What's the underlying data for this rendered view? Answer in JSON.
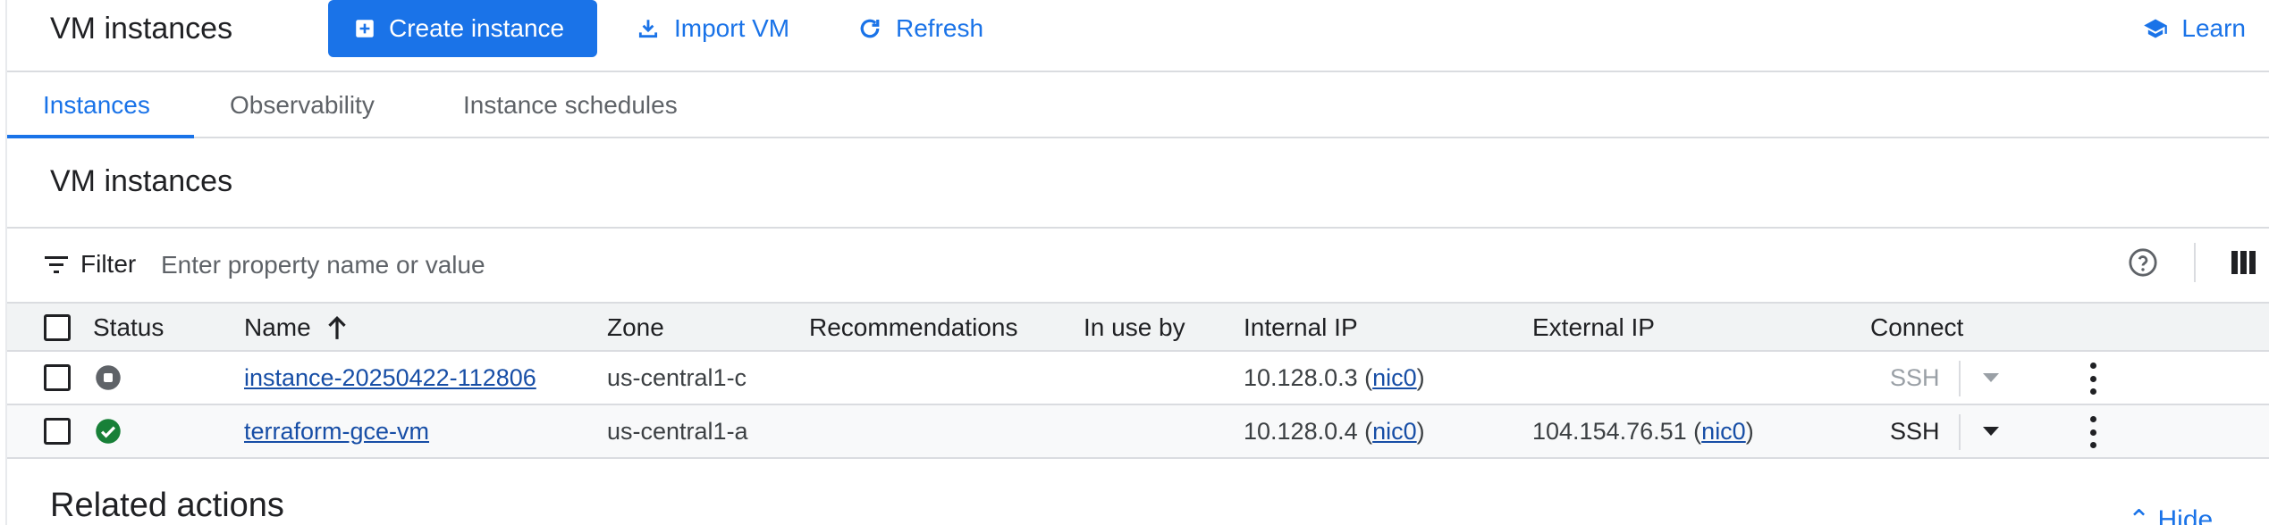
{
  "header": {
    "title": "VM instances",
    "create_label": "Create instance",
    "import_label": "Import VM",
    "refresh_label": "Refresh",
    "learn_label": "Learn"
  },
  "tabs": [
    {
      "label": "Instances",
      "active": true
    },
    {
      "label": "Observability",
      "active": false
    },
    {
      "label": "Instance schedules",
      "active": false
    }
  ],
  "section_title": "VM instances",
  "filter": {
    "label": "Filter",
    "placeholder": "Enter property name or value"
  },
  "table": {
    "columns": [
      "Status",
      "Name",
      "Zone",
      "Recommendations",
      "In use by",
      "Internal IP",
      "External IP",
      "Connect"
    ],
    "rows": [
      {
        "status": "stopped",
        "name": "instance-20250422-112806",
        "zone": "us-central1-c",
        "recommendations": "",
        "in_use_by": "",
        "internal_ip": "10.128.0.3",
        "internal_nic": "nic0",
        "external_ip": "",
        "external_nic": "",
        "connect": "SSH",
        "connect_enabled": false
      },
      {
        "status": "running",
        "name": "terraform-gce-vm",
        "zone": "us-central1-a",
        "recommendations": "",
        "in_use_by": "",
        "internal_ip": "10.128.0.4",
        "internal_nic": "nic0",
        "external_ip": "104.154.76.51",
        "external_nic": "nic0",
        "connect": "SSH",
        "connect_enabled": true
      }
    ]
  },
  "related_actions": "Related actions",
  "hide_label": "Hide",
  "colors": {
    "primary": "#1a73e8",
    "running": "#188038",
    "stopped": "#5f6368"
  }
}
